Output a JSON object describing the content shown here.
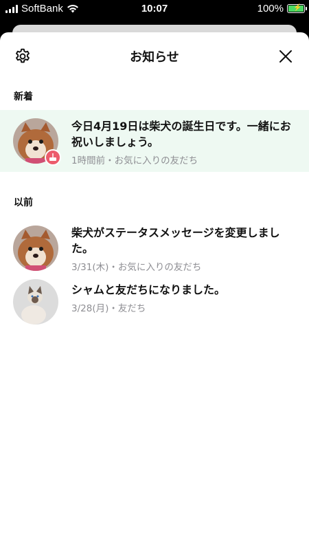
{
  "status_bar": {
    "carrier": "SoftBank",
    "time": "10:07",
    "battery": "100%"
  },
  "header": {
    "title": "お知らせ"
  },
  "sections": {
    "new_label": "新着",
    "old_label": "以前"
  },
  "notifications": [
    {
      "title": "今日4月19日は柴犬の誕生日です。一緒にお祝いしましょう。",
      "meta": "1時間前・お気に入りの友だち",
      "avatar": "shiba-inu-photo",
      "badge": "cake-icon"
    },
    {
      "title": "柴犬がステータスメッセージを変更しました。",
      "meta": "3/31(木)・お気に入りの友だち",
      "avatar": "shiba-inu-photo"
    },
    {
      "title": "シャムと友だちになりました。",
      "meta": "3/28(月)・友だち",
      "avatar": "siamese-cat-photo"
    }
  ],
  "colors": {
    "highlight_bg": "#eef9f2",
    "badge": "#ec5b6c",
    "meta_text": "#8e8e93",
    "battery": "#4cd964"
  }
}
